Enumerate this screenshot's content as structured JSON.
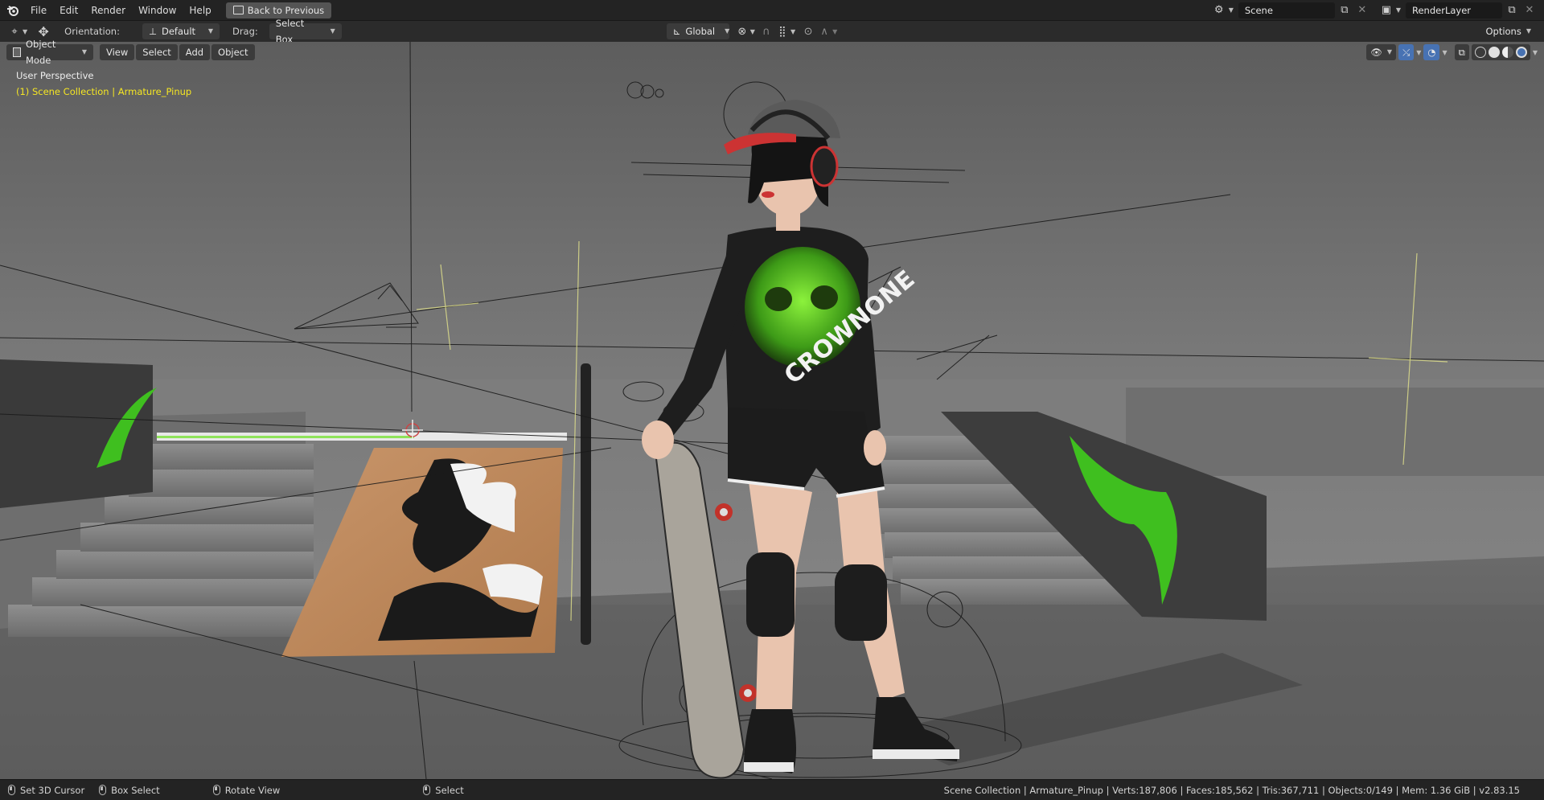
{
  "topbar": {
    "menus": [
      "File",
      "Edit",
      "Render",
      "Window",
      "Help"
    ],
    "back_button": "Back to Previous",
    "scene_name": "Scene",
    "layer_name": "RenderLayer"
  },
  "toolheader": {
    "orientation_label": "Orientation:",
    "orientation_value": "Default",
    "drag_label": "Drag:",
    "drag_value": "Select Box",
    "transform_orientation": "Global",
    "options_label": "Options"
  },
  "viewheader": {
    "mode": "Object Mode",
    "menus": [
      "View",
      "Select",
      "Add",
      "Object"
    ]
  },
  "viewport": {
    "perspective": "User Perspective",
    "collection": "(1) Scene Collection | Armature_Pinup",
    "shirt_text": "CROWNONE"
  },
  "statusbar": {
    "left_items": [
      "Set 3D Cursor",
      "Box Select",
      "Rotate View",
      "Select"
    ],
    "stats": "Scene Collection | Armature_Pinup | Verts:187,806 | Faces:185,562 | Tris:367,711 | Objects:0/149 | Mem: 1.36 GiB | v2.83.15"
  },
  "colors": {
    "accent_blue": "#4772b3",
    "overlay_yellow": "#f5e623",
    "graffiti_green": "#3fbf1f"
  }
}
